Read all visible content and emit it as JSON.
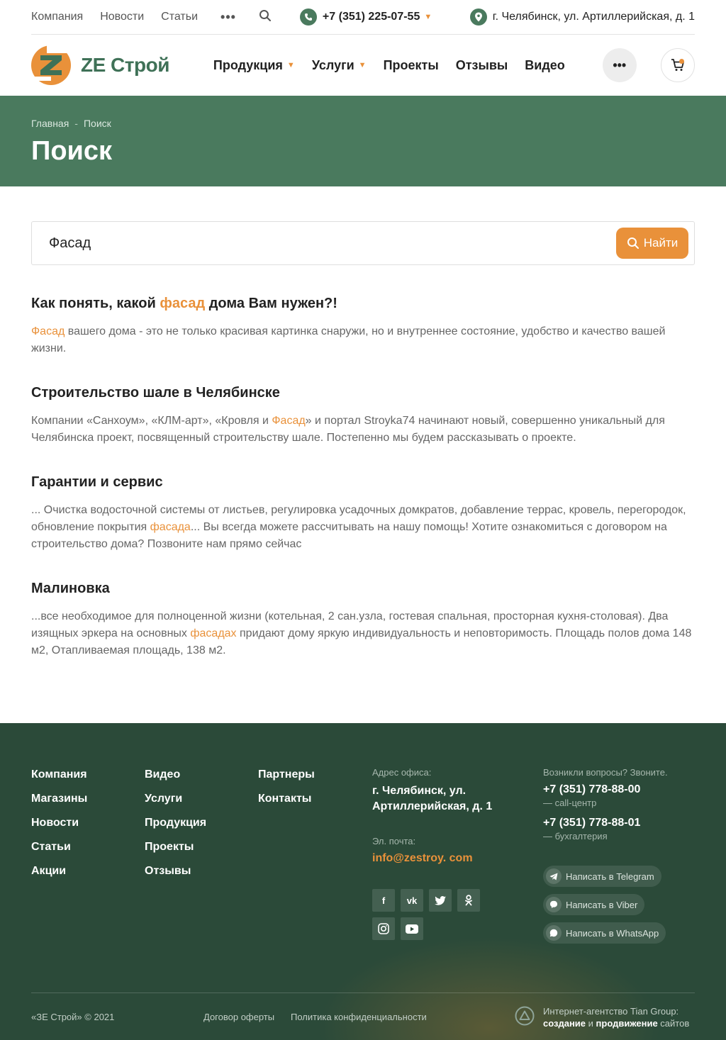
{
  "topbar": {
    "links": [
      "Компания",
      "Новости",
      "Статьи"
    ],
    "more": "•••",
    "phone": "+7 (351) 225-07-55",
    "address": "г. Челябинск, ул. Артиллерийская, д. 1"
  },
  "header": {
    "logo_text": "ZE Строй",
    "nav": [
      "Продукция",
      "Услуги",
      "Проекты",
      "Отзывы",
      "Видео"
    ],
    "more": "•••"
  },
  "hero": {
    "crumb_home": "Главная",
    "crumb_sep": "-",
    "crumb_current": "Поиск",
    "title": "Поиск"
  },
  "search": {
    "value": "Фасад",
    "button": "Найти"
  },
  "results": [
    {
      "title_before": "Как понять, какой ",
      "title_hl": "фасад",
      "title_after": " дома Вам нужен?!",
      "text_before": "",
      "text_hl": "Фасад",
      "text_after": " вашего дома - это не только красивая картинка снаружи, но и внутреннее состояние, удобство и качество вашей жизни."
    },
    {
      "title": "Строительство шале в Челябинске",
      "text_before": "Компании «Санхоум», «КЛМ-арт», «Кровля и ",
      "text_hl": "Фасад",
      "text_after": "» и портал Stroyka74 начинают новый, совершенно уникальный для Челябинска проект, посвященный строительству шале. Постепенно мы будем рассказывать о проекте."
    },
    {
      "title": "Гарантии и сервис",
      "text_before": "... Очистка водосточной системы от листьев, регулировка усадочных домкратов, добавление террас, кровель, перегородок, обновление покрытия ",
      "text_hl": "фасада",
      "text_after": "... Вы всегда можете рассчитывать на нашу помощь! Хотите ознакомиться с договором на строительство дома? Позвоните нам прямо сейчас"
    },
    {
      "title": "Малиновка",
      "text_before": "...все необходимое для полноценной жизни (котельная, 2 сан.узла, гостевая спальная, просторная кухня-столовая). Два изящных эркера на основных ",
      "text_hl": "фасадах",
      "text_after": " придают дому яркую индивидуальность и неповторимость. Площадь полов дома 148 м2, Отапливаемая площадь, 138 м2."
    }
  ],
  "footer": {
    "col1": [
      "Компания",
      "Магазины",
      "Новости",
      "Статьи",
      "Акции"
    ],
    "col2": [
      "Видео",
      "Услуги",
      "Продукция",
      "Проекты",
      "Отзывы"
    ],
    "col3": [
      "Партнеры",
      "Контакты"
    ],
    "address_label": "Адрес офиса:",
    "address_line1": "г. Челябинск, ул.",
    "address_line2": "Артиллерийская, д. 1",
    "email_label": "Эл. почта:",
    "email": "info@zestroy. com",
    "questions_label": "Возникли вопросы? Звоните.",
    "phone1": "+7 (351) 778-88-00",
    "phone1_note": "— call-центр",
    "phone2": "+7 (351) 778-88-01",
    "phone2_note": "— бухгалтерия",
    "messengers": [
      "Написать в Telegram",
      "Написать в Viber",
      "Написать в WhatsApp"
    ],
    "copyright": "«ЗЕ Строй» © 2021",
    "offer": "Договор оферты",
    "privacy": "Политика конфиденциальности",
    "agency_line1": "Интернет-агентство Tian Group:",
    "agency_create": "создание",
    "agency_and": " и ",
    "agency_promote": "продвижение",
    "agency_sites": " сайтов"
  },
  "colors": {
    "brand_green": "#4a7a5e",
    "accent_orange": "#e9913a",
    "footer_bg": "#2b4a39"
  }
}
